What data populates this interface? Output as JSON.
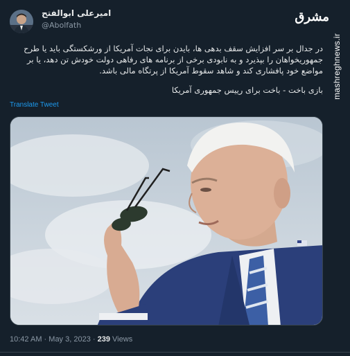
{
  "author": {
    "name": "امیرعلی ابوالفتح",
    "handle": "@Abolfath"
  },
  "watermark": {
    "logo": "مشرق",
    "url": "mashreghnews.ir"
  },
  "tweet": {
    "paragraph1": "در جدال بر سر افزایش سقف بدهی ها، بایدن برای نجات آمریکا از ورشکستگی باید یا طرح جمهوریخواهان را بپذیرد و به نابودی برخی از برنامه های رفاهی دولت خودش تن دهد، یا بر مواضع خود پافشاری کند و شاهد سقوط آمریکا از پرتگاه مالی باشد.",
    "paragraph2": "بازی باخت - باخت برای رییس جمهوری آمریکا",
    "translate_label": "Translate Tweet"
  },
  "meta": {
    "time": "10:42 AM",
    "separator": "·",
    "date": "May 3, 2023",
    "views_count": "239",
    "views_label": "Views"
  },
  "colors": {
    "background": "#15202b",
    "link": "#1d9bf0",
    "secondary_text": "#8b98a5"
  },
  "icons": {
    "avatar": "user-avatar"
  }
}
